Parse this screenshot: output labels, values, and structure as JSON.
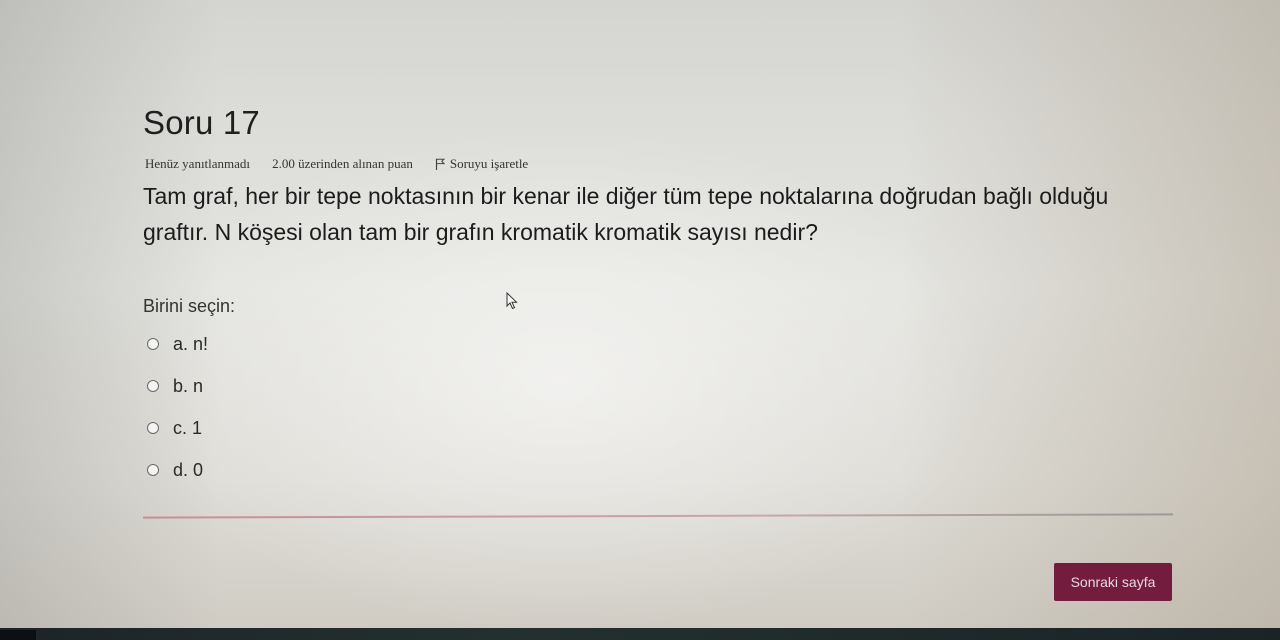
{
  "question": {
    "title": "Soru 17",
    "state": "Henüz yanıtlanmadı",
    "grade": "2.00 üzerinden alınan puan",
    "flag_label": "Soruyu işaretle",
    "text": "Tam graf, her bir tepe noktasının bir kenar ile diğer tüm tepe noktalarına doğrudan bağlı olduğu graftır. N köşesi olan tam bir grafın kromatik kromatik sayısı nedir?"
  },
  "answer_prompt": "Birini seçin:",
  "answers": [
    {
      "label": "a. n!",
      "selected": false
    },
    {
      "label": "b. n",
      "selected": false
    },
    {
      "label": "c. 1",
      "selected": false
    },
    {
      "label": "d. 0",
      "selected": false
    }
  ],
  "navigation": {
    "next_label": "Sonraki sayfa"
  },
  "colors": {
    "button_bg": "#741c3e",
    "divider": "#c98c96"
  },
  "icons": {
    "flag": "flag-icon",
    "cursor": "mouse-cursor-icon",
    "radio": "radio-button"
  }
}
